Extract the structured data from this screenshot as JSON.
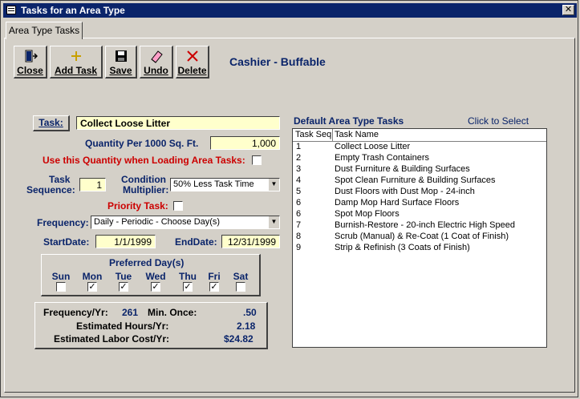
{
  "window": {
    "title": "Tasks for an Area Type",
    "close_glyph": "✕"
  },
  "tabs": [
    {
      "label": "Area Type Tasks"
    }
  ],
  "toolbar": {
    "close_label": "Close",
    "add_label": "Add Task",
    "save_label": "Save",
    "undo_label": "Undo",
    "delete_label": "Delete"
  },
  "area_type_name": "Cashier - Buffable",
  "task": {
    "button_label": "Task:",
    "value": "Collect Loose Litter"
  },
  "quantity": {
    "label": "Quantity Per 1000 Sq. Ft.",
    "value": "1,000"
  },
  "use_quantity": {
    "label": "Use this Quantity when Loading Area Tasks:",
    "checked": false
  },
  "task_sequence": {
    "label_line1": "Task",
    "label_line2": "Sequence:",
    "value": "1"
  },
  "condition_multiplier": {
    "label_line1": "Condition",
    "label_line2": "Multiplier:",
    "value": "50% Less Task Time"
  },
  "priority_task": {
    "label": "Priority Task:",
    "checked": false
  },
  "frequency": {
    "label": "Frequency:",
    "value": "Daily - Periodic - Choose Day(s)"
  },
  "start_date": {
    "label": "StartDate:",
    "value": "1/1/1999"
  },
  "end_date": {
    "label": "EndDate:",
    "value": "12/31/1999"
  },
  "preferred_days": {
    "title": "Preferred Day(s)",
    "days": [
      {
        "label": "Sun",
        "checked": false
      },
      {
        "label": "Mon",
        "checked": true
      },
      {
        "label": "Tue",
        "checked": true
      },
      {
        "label": "Wed",
        "checked": true
      },
      {
        "label": "Thu",
        "checked": true
      },
      {
        "label": "Fri",
        "checked": true
      },
      {
        "label": "Sat",
        "checked": false
      }
    ]
  },
  "summary": {
    "freq_label": "Frequency/Yr:",
    "freq_value": "261",
    "min_once_label": "Min. Once:",
    "min_once_value": ".50",
    "hours_label": "Estimated Hours/Yr:",
    "hours_value": "2.18",
    "cost_label": "Estimated Labor Cost/Yr:",
    "cost_value": "$24.82"
  },
  "default_tasks": {
    "title": "Default Area Type Tasks",
    "hint": "Click to Select",
    "col_seq": "Task Seq",
    "col_name": "Task Name",
    "rows": [
      {
        "seq": "1",
        "name": "Collect Loose Litter"
      },
      {
        "seq": "2",
        "name": "Empty Trash Containers"
      },
      {
        "seq": "3",
        "name": "Dust Furniture & Building Surfaces"
      },
      {
        "seq": "4",
        "name": "Spot Clean Furniture & Building Surfaces"
      },
      {
        "seq": "5",
        "name": "Dust Floors with Dust Mop - 24-inch"
      },
      {
        "seq": "6",
        "name": "Damp Mop Hard Surface Floors"
      },
      {
        "seq": "6",
        "name": "Spot Mop Floors"
      },
      {
        "seq": "7",
        "name": "Burnish-Restore - 20-inch Electric High Speed"
      },
      {
        "seq": "8",
        "name": "Scrub (Manual) & Re-Coat (1 Coat of Finish)"
      },
      {
        "seq": "9",
        "name": "Strip & Refinish (3 Coats of Finish)"
      }
    ]
  },
  "colors": {
    "accent": "#0a246a",
    "warning": "#cc0000",
    "field_highlight": "#ffffcc",
    "face": "#d4d0c8"
  }
}
